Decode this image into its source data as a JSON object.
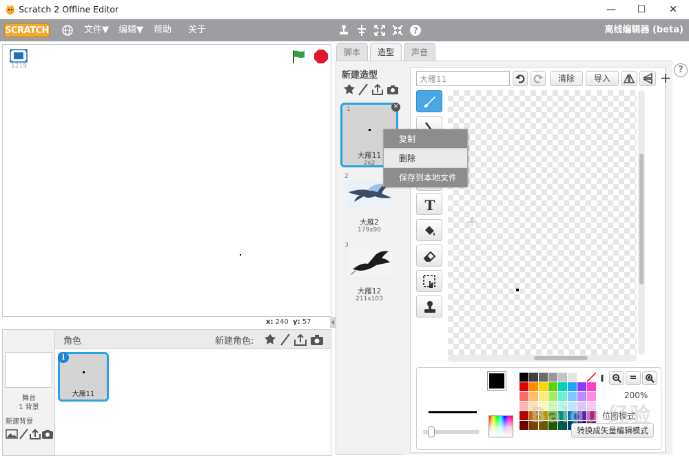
{
  "window": {
    "title": "Scratch 2 Offline Editor",
    "minimize": "—",
    "maximize": "☐",
    "close": "✕"
  },
  "menubar": {
    "logo": "SCRATCH",
    "file": "文件▼",
    "edit": "编辑▼",
    "help": "帮助",
    "about": "关于",
    "right_label": "离线编辑器 (beta)"
  },
  "stage": {
    "version": "1219",
    "coords_x_label": "x:",
    "coords_x": "240",
    "coords_y_label": "y:",
    "coords_y": "57"
  },
  "sprites": {
    "header_label": "角色",
    "new_sprite_label": "新建角色:",
    "stage_label": "舞台",
    "stage_backdrops": "1 背景",
    "new_backdrop_label": "新建背景",
    "items": [
      {
        "name": "大雁11",
        "info": "i"
      }
    ]
  },
  "tabs": [
    {
      "label": "脚本",
      "active": false
    },
    {
      "label": "造型",
      "active": true
    },
    {
      "label": "声音",
      "active": false
    }
  ],
  "costumes": {
    "header": "新建造型",
    "items": [
      {
        "num": "1",
        "name": "大雁11",
        "size": "2x2",
        "selected": true
      },
      {
        "num": "2",
        "name": "大雁2",
        "size": "179x90",
        "selected": false
      },
      {
        "num": "3",
        "name": "大雁12",
        "size": "211x103",
        "selected": false
      }
    ]
  },
  "context_menu": {
    "items": [
      {
        "label": "复制"
      },
      {
        "label": "删除"
      },
      {
        "label": "保存到本地文件"
      }
    ]
  },
  "editor": {
    "name_placeholder": "大雁11",
    "clear_label": "清除",
    "import_label": "导入",
    "zoom_level": "200%",
    "mode_label": "位图模式",
    "convert_label": "转换成矢量编辑模式",
    "zoom_out": "−",
    "zoom_reset": "=",
    "zoom_in": "+"
  },
  "watermark": "Baidu 经验",
  "colors": {
    "accent": "#27a3de",
    "menubar": "#9c9ea1",
    "logo": "#f7a829",
    "flag": "#2e8b3a",
    "stop": "#e3152b"
  }
}
